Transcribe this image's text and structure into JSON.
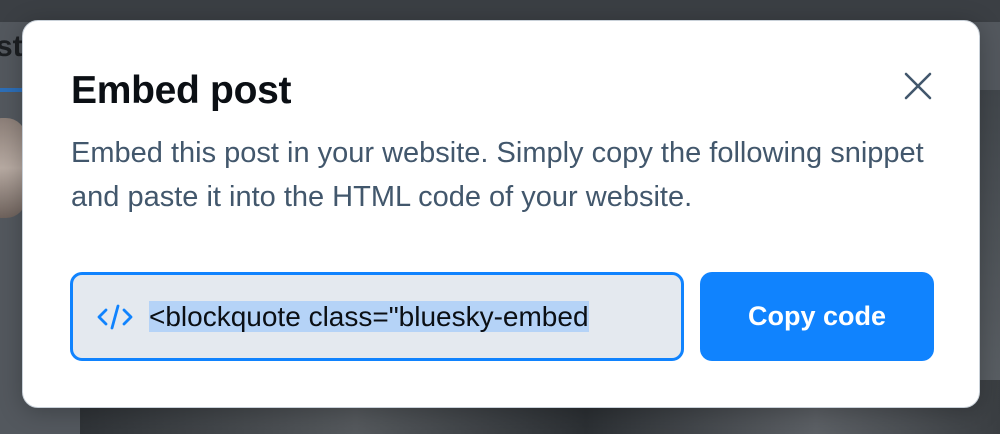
{
  "background": {
    "tab_text": "st"
  },
  "modal": {
    "title": "Embed post",
    "description": "Embed this post in your website. Simply copy the following snippet and paste it into the HTML code of your website.",
    "close_icon": "close-icon",
    "embed_field": {
      "icon": "code-icon",
      "value": "<blockquote class=\"bluesky-embed"
    },
    "copy_button_label": "Copy code"
  },
  "colors": {
    "accent": "#1083fe",
    "title": "#0b0f14",
    "description": "#42576c",
    "field_bg": "#e4e9ef",
    "selection": "#b5d3f7"
  }
}
